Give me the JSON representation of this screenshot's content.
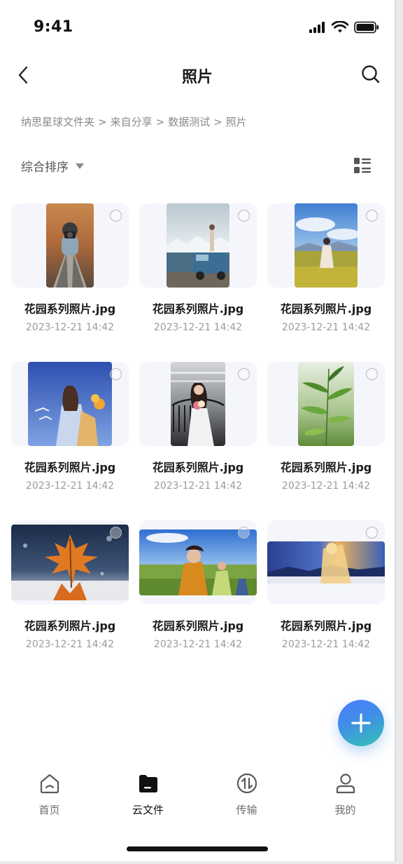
{
  "status_bar": {
    "time": "9:41"
  },
  "nav": {
    "title": "照片",
    "back_icon": "chevron-left-icon",
    "search_icon": "search-icon"
  },
  "breadcrumb": {
    "items": [
      "纳思星球文件夹",
      "来自分享",
      "数据测试",
      "照片"
    ],
    "separator": ">"
  },
  "sort": {
    "label": "综合排序"
  },
  "files": [
    {
      "name": "花园系列照片.jpg",
      "date": "2023-12-21 14:42",
      "image": "person-with-camera-on-boardwalk"
    },
    {
      "name": "花园系列照片.jpg",
      "date": "2023-12-21 14:42",
      "image": "person-on-blue-van-mountains"
    },
    {
      "name": "花园系列照片.jpg",
      "date": "2023-12-21 14:42",
      "image": "woman-in-meadow-blue-sky"
    },
    {
      "name": "花园系列照片.jpg",
      "date": "2023-12-21 14:42",
      "image": "woman-with-flowers-seagulls"
    },
    {
      "name": "花园系列照片.jpg",
      "date": "2023-12-21 14:42",
      "image": "bride-with-bouquet"
    },
    {
      "name": "花园系列照片.jpg",
      "date": "2023-12-21 14:42",
      "image": "bamboo-leaves"
    },
    {
      "name": "花园系列照片.jpg",
      "date": "2023-12-21 14:42",
      "image": "orange-maple-leaf-snow"
    },
    {
      "name": "花园系列照片.jpg",
      "date": "2023-12-21 14:42",
      "image": "girls-running-in-field"
    },
    {
      "name": "花园系列照片.jpg",
      "date": "2023-12-21 14:42",
      "image": "panorama-double-exposure"
    }
  ],
  "fab": {
    "icon": "plus-icon"
  },
  "tabs": [
    {
      "label": "首页",
      "icon": "home-icon",
      "active": false
    },
    {
      "label": "云文件",
      "icon": "folder-icon",
      "active": true
    },
    {
      "label": "传输",
      "icon": "transfer-icon",
      "active": false
    },
    {
      "label": "我的",
      "icon": "user-icon",
      "active": false
    }
  ],
  "colors": {
    "accent_gradient_start": "#4c7bff",
    "accent_gradient_end": "#36c3b4",
    "thumb_background": "#f5f6fb",
    "muted_text": "#9a9aa0"
  }
}
